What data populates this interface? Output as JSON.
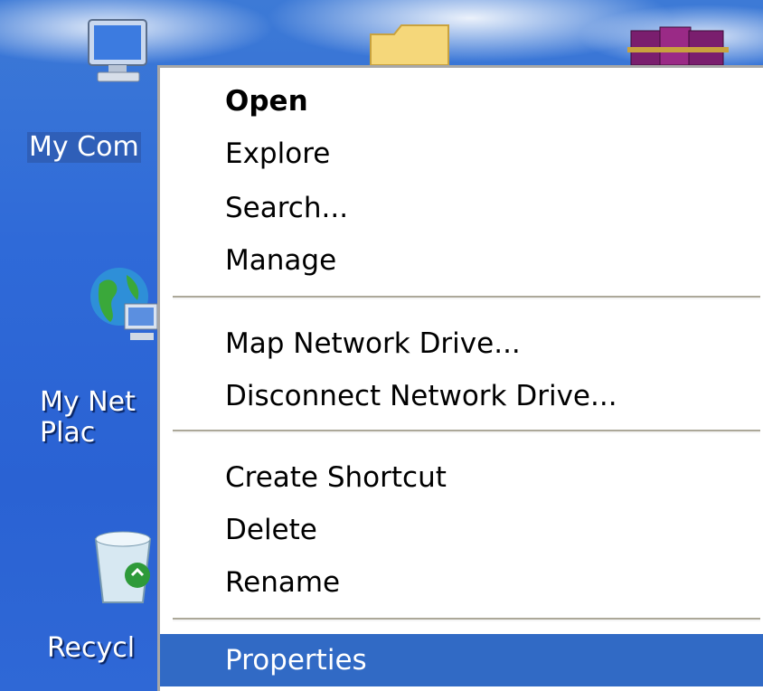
{
  "desktop": {
    "icons": [
      {
        "label": "My Com",
        "icon": "my-computer-icon",
        "selected": true
      },
      {
        "label": "My Net\nPlac",
        "icon": "my-network-places-icon",
        "selected": false
      },
      {
        "label": "Recycl",
        "icon": "recycle-bin-icon",
        "selected": false
      },
      {
        "label": "",
        "icon": "folder-icon"
      },
      {
        "label": "",
        "icon": "winrar-books-icon"
      }
    ]
  },
  "context_menu": {
    "items": [
      {
        "label": "Open",
        "bold": true
      },
      {
        "label": "Explore"
      },
      {
        "label": "Search..."
      },
      {
        "label": "Manage"
      },
      {
        "label": "Map Network Drive..."
      },
      {
        "label": "Disconnect Network Drive..."
      },
      {
        "label": "Create Shortcut"
      },
      {
        "label": "Delete"
      },
      {
        "label": "Rename"
      },
      {
        "label": "Properties",
        "highlighted": true
      }
    ]
  },
  "colors": {
    "desktop_blue": "#2f68d6",
    "highlight": "#316ac5",
    "menu_bg": "#ffffff"
  }
}
